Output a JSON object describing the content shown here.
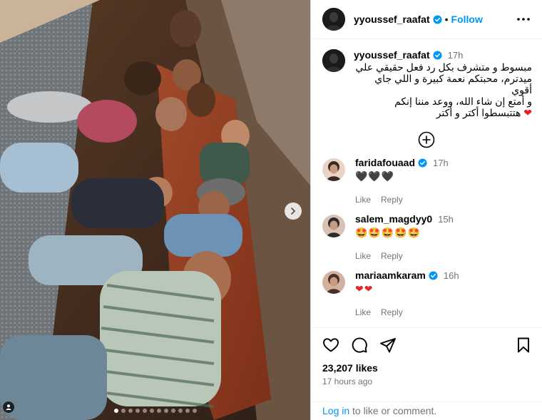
{
  "post": {
    "username": "yyoussef_raafat",
    "follow_label": "Follow",
    "bullet": "•",
    "verified_color": "#0095f6"
  },
  "caption": {
    "username": "yyoussef_raafat",
    "time": "17h",
    "line1": "مبسوط و متشرف بكل رد فعل حقيقي علي",
    "line2": "ميدترم، محبتكم نعمة كبيرة و اللي جاي أقوي",
    "line3": "و أمتع إن شاء الله، ووعد مننا إنكم",
    "line4": "هتتبسطوا أكتر و أكتر",
    "heart": "❤"
  },
  "comments": [
    {
      "username": "faridafouaad",
      "verified": true,
      "time": "17h",
      "text": "🖤🖤🖤",
      "like": "Like",
      "reply": "Reply"
    },
    {
      "username": "salem_magdyy0",
      "verified": false,
      "time": "15h",
      "text": "🤩🤩🤩🤩🤩",
      "like": "Like",
      "reply": "Reply"
    },
    {
      "username": "mariaamkaram",
      "verified": true,
      "time": "16h",
      "text": "❤❤",
      "like": "Like",
      "reply": "Reply"
    }
  ],
  "footer": {
    "likes": "23,207 likes",
    "ago": "17 hours ago",
    "login_link": "Log in",
    "login_rest": " to like or comment."
  },
  "carousel": {
    "total": 12,
    "active_index": 0
  },
  "icons": [
    "more-icon",
    "verified-icon",
    "load-more-icon",
    "heart-icon",
    "comment-icon",
    "share-icon",
    "save-icon",
    "next-icon",
    "tag-user-icon"
  ],
  "colors": {
    "accent": "#0095f6",
    "muted": "#737373",
    "border": "#dbdbdb"
  }
}
